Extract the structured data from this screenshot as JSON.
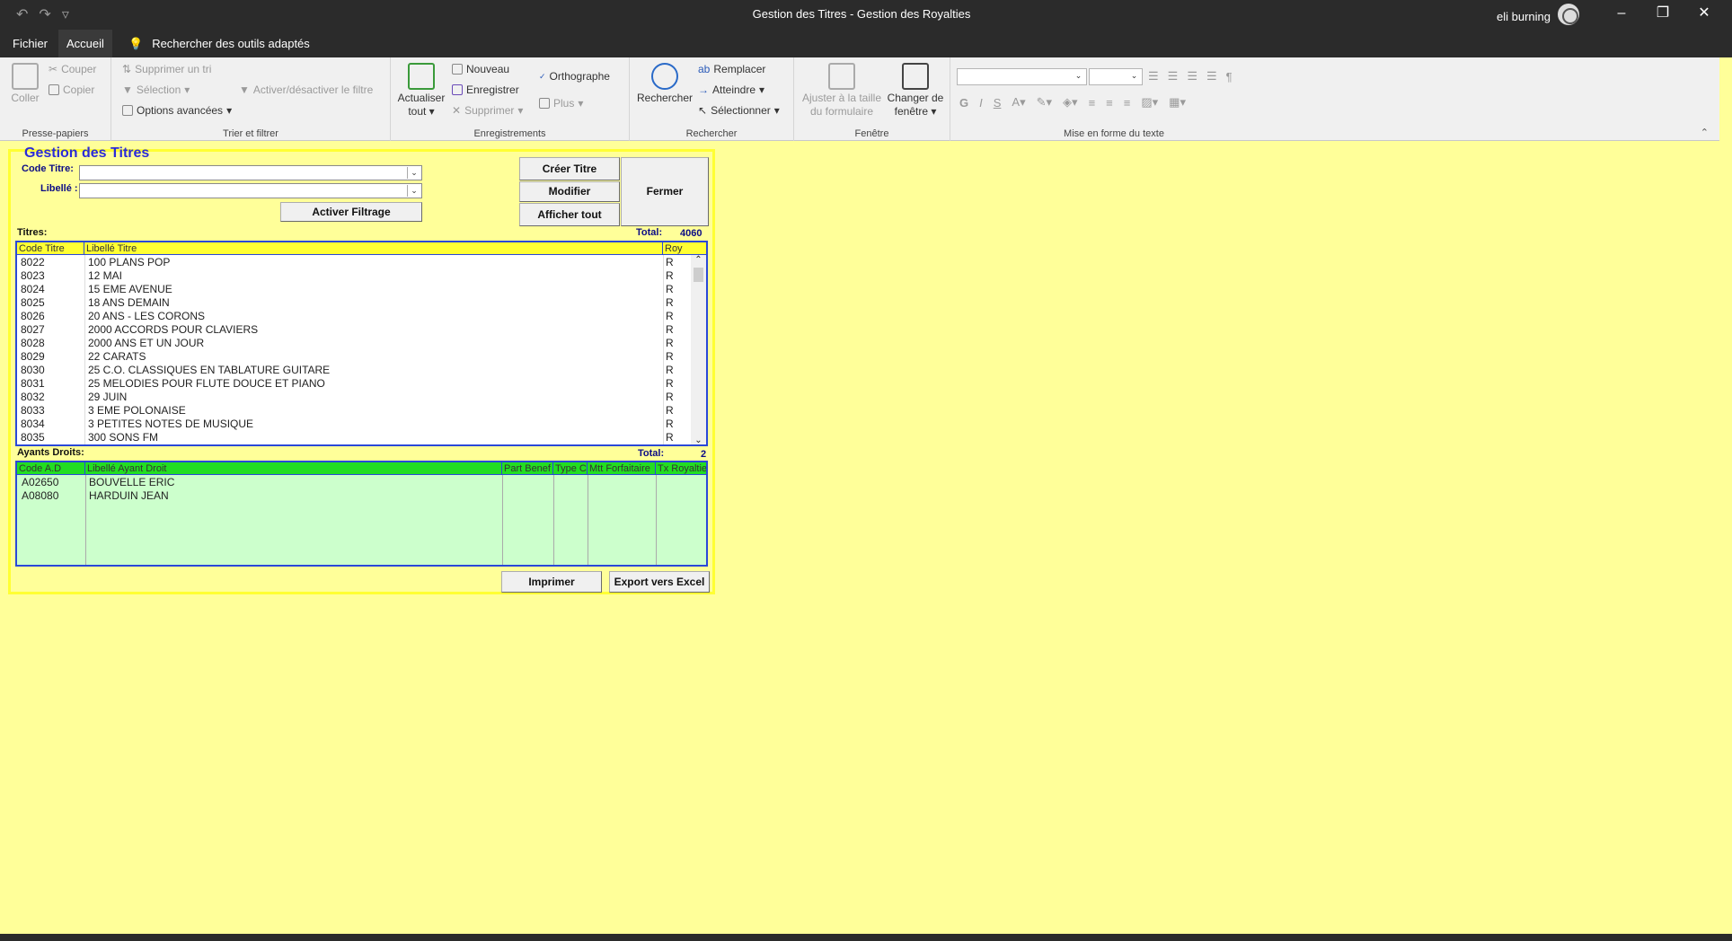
{
  "window": {
    "title": "Gestion des Titres  -  Gestion des Royalties",
    "user": "eli burning"
  },
  "tabs": {
    "file": "Fichier",
    "home": "Accueil",
    "search": "Rechercher des outils adaptés"
  },
  "ribbon": {
    "clipboard": {
      "paste": "Coller",
      "cut": "Couper",
      "copy": "Copier",
      "group": "Presse-papiers"
    },
    "sort": {
      "remove_sort": "Supprimer un tri",
      "selection": "Sélection",
      "advanced": "Options avancées",
      "toggle_filter": "Activer/désactiver le filtre",
      "group": "Trier et filtrer"
    },
    "records": {
      "refresh_1": "Actualiser",
      "refresh_2": "tout",
      "new": "Nouveau",
      "save": "Enregistrer",
      "delete": "Supprimer",
      "spelling": "Orthographe",
      "more": "Plus",
      "group": "Enregistrements"
    },
    "find": {
      "find": "Rechercher",
      "replace": "Remplacer",
      "goto": "Atteindre",
      "select": "Sélectionner",
      "group": "Rechercher"
    },
    "window": {
      "fit_1": "Ajuster à la taille",
      "fit_2": "du formulaire",
      "switch_1": "Changer de",
      "switch_2": "fenêtre",
      "group": "Fenêtre"
    },
    "text": {
      "bold": "G",
      "italic": "I",
      "underline": "S",
      "group": "Mise en forme du texte"
    }
  },
  "form": {
    "title": "Gestion des Titres",
    "code_label": "Code Titre:",
    "libelle_label": "Libellé :",
    "filter_button": "Activer Filtrage",
    "create_button": "Créer Titre",
    "modify_button": "Modifier",
    "show_all_button": "Afficher tout",
    "close_button": "Fermer",
    "titres_label": "Titres:",
    "total_label": "Total:",
    "titres_total": "4060",
    "ayants_label": "Ayants Droits:",
    "ayants_total": "2",
    "print_button": "Imprimer",
    "export_button": "Export vers Excel"
  },
  "titres": {
    "headers": [
      "Code Titre",
      "Libellé Titre",
      "Roy"
    ],
    "rows": [
      {
        "code": "8022",
        "label": "100 PLANS POP",
        "roy": "R"
      },
      {
        "code": "8023",
        "label": "12 MAI",
        "roy": "R"
      },
      {
        "code": "8024",
        "label": "15 EME AVENUE",
        "roy": "R"
      },
      {
        "code": "8025",
        "label": "18 ANS DEMAIN",
        "roy": "R"
      },
      {
        "code": "8026",
        "label": "20 ANS - LES CORONS",
        "roy": "R"
      },
      {
        "code": "8027",
        "label": "2000 ACCORDS POUR CLAVIERS",
        "roy": "R"
      },
      {
        "code": "8028",
        "label": "2000 ANS ET UN JOUR",
        "roy": "R"
      },
      {
        "code": "8029",
        "label": "22 CARATS",
        "roy": "R"
      },
      {
        "code": "8030",
        "label": "25 C.O. CLASSIQUES EN TABLATURE GUITARE",
        "roy": "R"
      },
      {
        "code": "8031",
        "label": "25 MELODIES POUR FLUTE DOUCE ET PIANO",
        "roy": "R"
      },
      {
        "code": "8032",
        "label": "29 JUIN",
        "roy": "R"
      },
      {
        "code": "8033",
        "label": "3 EME POLONAISE",
        "roy": "R"
      },
      {
        "code": "8034",
        "label": "3 PETITES NOTES DE MUSIQUE",
        "roy": "R"
      },
      {
        "code": "8035",
        "label": "300 SONS FM",
        "roy": "R"
      }
    ]
  },
  "ayants": {
    "headers": [
      "Code A.D",
      "Libellé Ayant Droit",
      "Part Benef",
      "Type C",
      "Mtt Forfaitaire",
      "Tx Royaltie"
    ],
    "rows": [
      {
        "code": "A02650",
        "name": "BOUVELLE ERIC"
      },
      {
        "code": "A08080",
        "name": "HARDUIN JEAN"
      }
    ]
  },
  "colors": {
    "background": "#ffff99",
    "border_yellow": "#ffff33",
    "list_border": "#2a48d8",
    "header_yellow": "#ffff33",
    "header_green": "#22dd22",
    "ayants_bg": "#ccffcc"
  }
}
